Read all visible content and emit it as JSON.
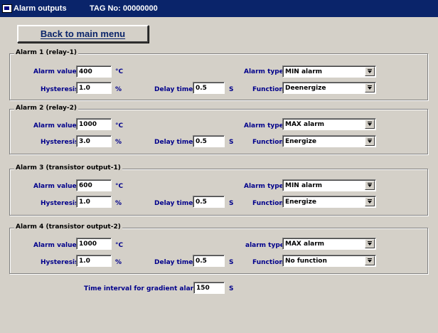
{
  "window": {
    "title": "Alarm outputs",
    "tag": "TAG No: 00000000",
    "app_icon": "window-app-icon"
  },
  "back_button": {
    "label": "Back to main menu"
  },
  "labels": {
    "alarm_value": "Alarm value",
    "hysteresis": "Hysteresis",
    "delay_time": "Delay time",
    "alarm_type": "Alarm type",
    "alarm_type_lower": "alarm type",
    "function": "Function"
  },
  "units": {
    "temp": "°C",
    "percent": "%",
    "seconds": "S"
  },
  "alarms": [
    {
      "title": "Alarm 1 (relay-1)",
      "alarm_value": "400",
      "hysteresis": "1.0",
      "delay_time": "0.5",
      "alarm_type": "MIN alarm",
      "function": "Deenergize"
    },
    {
      "title": "Alarm 2 (relay-2)",
      "alarm_value": "1000",
      "hysteresis": "3.0",
      "delay_time": "0.5",
      "alarm_type": "MAX alarm",
      "function": "Energize"
    },
    {
      "title": "Alarm 3 (transistor output-1)",
      "alarm_value": "600",
      "hysteresis": "1.0",
      "delay_time": "0.5",
      "alarm_type": "MIN alarm",
      "function": "Energize"
    },
    {
      "title": "Alarm 4 (transistor output-2)",
      "alarm_value": "1000",
      "hysteresis": "1.0",
      "delay_time": "0.5",
      "alarm_type": "MAX alarm",
      "function": "No function"
    }
  ],
  "gradient": {
    "label": "Time interval for gradient alarm",
    "value": "150",
    "unit": "S"
  }
}
